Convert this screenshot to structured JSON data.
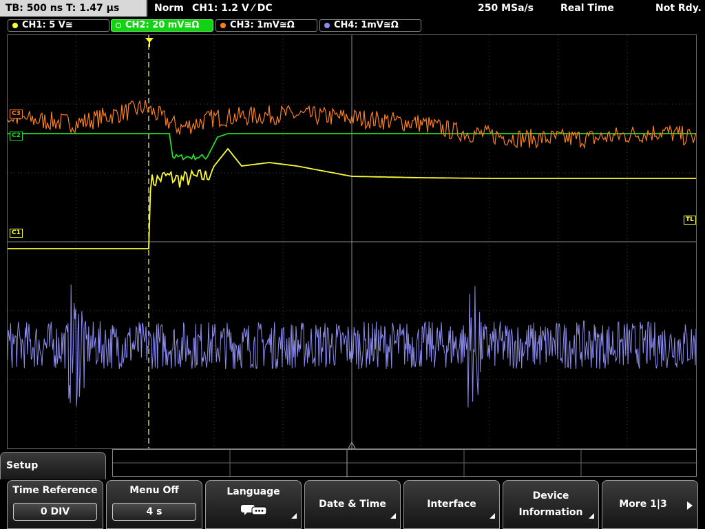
{
  "status": {
    "timebase": "TB: 500 ns   T: 1.47 µs",
    "trigger_mode": "Norm",
    "trigger_source": "CH1: 1.2 V ⁄ DC",
    "sample_rate": "250 MSa/s",
    "acq_mode": "Real Time",
    "ready": "Not Rdy."
  },
  "channels": [
    {
      "label": "CH1: 5 V≅",
      "color": "#ffff33"
    },
    {
      "label": "CH2: 20 mV≅Ω",
      "color": "#22dd22"
    },
    {
      "label": "CH3: 1mV≅Ω",
      "color": "#ff7f1e"
    },
    {
      "label": "CH4: 1mV≅Ω",
      "color": "#8c8cf0"
    }
  ],
  "markers": {
    "ch1": "C1",
    "ch2": "C2",
    "ch3": "C3",
    "trigger_level": "TL",
    "trigger_point": "T"
  },
  "menu": {
    "title": "Setup",
    "softkeys": [
      {
        "label": "Time Reference",
        "value": "0 DIV"
      },
      {
        "label": "Menu Off",
        "value": "4 s"
      },
      {
        "label": "Language",
        "icon": "speech-bubble-icon"
      },
      {
        "label": "Date & Time"
      },
      {
        "label": "Interface"
      },
      {
        "label1": "Device",
        "label2": "Information"
      },
      {
        "label": "More 1|3",
        "icon": "arrow-right-icon"
      }
    ]
  },
  "chart_data": {
    "type": "line",
    "title": "",
    "xlabel": "",
    "ylabel": "",
    "grid": true,
    "divisions_x": 10,
    "divisions_y": 6,
    "trigger_position_div": 2.05,
    "series": [
      {
        "name": "CH1",
        "color": "#ffff33",
        "points_div": [
          [
            0,
            -0.1
          ],
          [
            2.05,
            -0.1
          ],
          [
            2.05,
            0.85
          ],
          [
            2.3,
            0.95
          ],
          [
            2.5,
            0.9
          ],
          [
            2.9,
            0.95
          ],
          [
            3.0,
            1.1
          ],
          [
            3.2,
            1.35
          ],
          [
            3.4,
            1.1
          ],
          [
            3.8,
            1.15
          ],
          [
            4.2,
            1.1
          ],
          [
            5.0,
            0.95
          ],
          [
            6.0,
            0.93
          ],
          [
            7.0,
            0.92
          ],
          [
            8.0,
            0.92
          ],
          [
            9.0,
            0.92
          ],
          [
            10.0,
            0.92
          ]
        ]
      },
      {
        "name": "CH2",
        "color": "#22dd22",
        "points_div": [
          [
            0,
            1.57
          ],
          [
            2.35,
            1.57
          ],
          [
            2.4,
            1.23
          ],
          [
            2.9,
            1.23
          ],
          [
            3.05,
            1.52
          ],
          [
            3.2,
            1.57
          ],
          [
            10.0,
            1.57
          ]
        ]
      },
      {
        "name": "CH3",
        "color": "#ff7f1e",
        "points_div": [
          [
            0,
            1.8
          ],
          [
            1.0,
            1.72
          ],
          [
            2.0,
            1.95
          ],
          [
            2.5,
            1.65
          ],
          [
            3.0,
            1.8
          ],
          [
            4.0,
            1.85
          ],
          [
            5.0,
            1.8
          ],
          [
            6.0,
            1.72
          ],
          [
            6.5,
            1.6
          ],
          [
            7.5,
            1.5
          ],
          [
            8.5,
            1.5
          ],
          [
            9.5,
            1.6
          ],
          [
            10.0,
            1.5
          ]
        ]
      },
      {
        "name": "CH4",
        "color": "#8c8cf0",
        "points_div": [
          [
            0,
            -1.5
          ],
          [
            10.0,
            -1.5
          ]
        ],
        "noise_amplitude_div": 0.35,
        "spikes_div": [
          1.0,
          6.75
        ]
      }
    ]
  }
}
